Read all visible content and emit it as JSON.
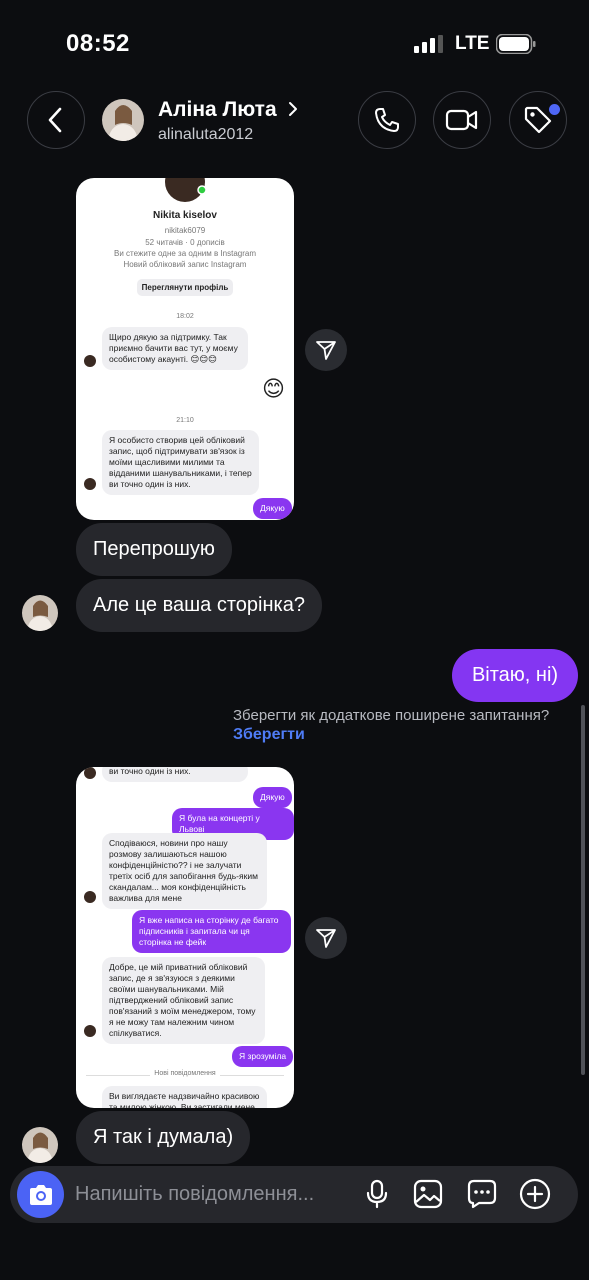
{
  "status_bar": {
    "time": "08:52",
    "network": "LTE"
  },
  "header": {
    "name": "Аліна Люта",
    "username": "alinaluta2012"
  },
  "screenshot1": {
    "profile_name": "Nikita kiselov",
    "profile_handle": "nikitak6079",
    "profile_stats": "52 читачів · 0 дописів",
    "profile_follow": "Ви стежите одне за одним в Instagram",
    "profile_new": "Новий обліковий запис Instagram",
    "profile_button": "Переглянути профіль",
    "time1": "18:02",
    "msg1": "Щиро дякую за підтримку. Так приємно бачити вас тут, у моєму особистому акаунті. 😊😊😊",
    "emoji": "😊",
    "time2": "21:10",
    "msg2": "Я особисто створив цей обліковий запис, щоб підтримувати зв'язок із моїми щасливими милими та відданими шанувальниками, і тепер ви точно один із них.",
    "reply": "Дякую"
  },
  "screenshot2": {
    "top_text": "ви точно один із них.",
    "reply1": "Дякую",
    "reply2": "Я була на концерті у Львові",
    "msg1": "Сподіваюся, новини про нашу розмову залишаються нашою конфіденційністю?? і не залучати третіх осіб для запобігання будь-яким скандалам... моя конфіденційність важлива для мене",
    "reply3": "Я вже написа на сторінку де багато підписників і запитала чи ця сторінка не фейк",
    "msg2": "Добре, це мій приватний обліковий запис, де я зв'язуюся з деякими своїми шанувальниками. Мій підтверджений обліковий запис пов'язаний з моїм менеджером, тому я не можу там належним чином спілкуватися.",
    "reply4": "Я зрозуміла",
    "divider": "Нові повідомлення",
    "msg3": "Ви виглядаєте надзвичайно красивою та милою жінкою. Ви застигали мене"
  },
  "chat": {
    "msg_sorry": "Перепрошую",
    "msg_question": "Але це ваша сторінка?",
    "msg_reply": "Вітаю, ні)",
    "faq_prompt": "Зберегти як додаткове поширене запитання?",
    "faq_save": "Зберегти",
    "msg_final": "Я так і думала)"
  },
  "composer": {
    "placeholder": "Напишіть повідомлення..."
  },
  "colors": {
    "accent_blue": "#4b63f5",
    "outgoing_purple": "#8436f2",
    "incoming_gray": "#26272c",
    "background": "#0c0d10"
  }
}
